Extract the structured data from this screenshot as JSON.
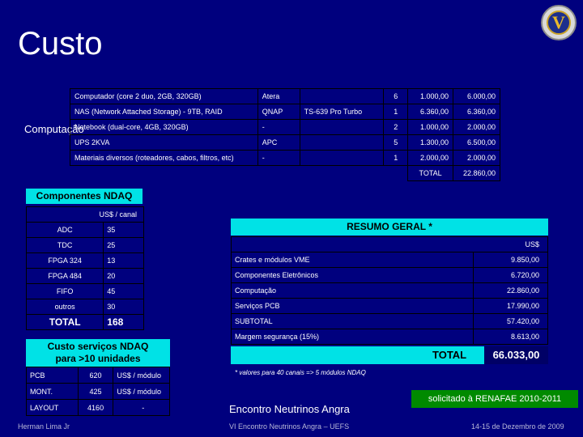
{
  "title": "Custo",
  "logo": {
    "letter": "V"
  },
  "computacao": {
    "label": "Computação",
    "rows": [
      {
        "item": "Computador (core 2 duo, 2GB, 320GB)",
        "brand": "Atera",
        "model": "",
        "qty": "6",
        "unit": "1.000,00",
        "total": "6.000,00"
      },
      {
        "item": "NAS (Network Attached Storage) - 9TB, RAID",
        "brand": "QNAP",
        "model": "TS-639 Pro Turbo",
        "qty": "1",
        "unit": "6.360,00",
        "total": "6.360,00"
      },
      {
        "item": "Notebook (dual-core, 4GB, 320GB)",
        "brand": "-",
        "model": "",
        "qty": "2",
        "unit": "1.000,00",
        "total": "2.000,00"
      },
      {
        "item": "UPS 2KVA",
        "brand": "APC",
        "model": "",
        "qty": "5",
        "unit": "1.300,00",
        "total": "6.500,00"
      },
      {
        "item": "Materiais diversos (roteadores, cabos, filtros, etc)",
        "brand": "-",
        "model": "",
        "qty": "1",
        "unit": "2.000,00",
        "total": "2.000,00"
      }
    ],
    "total_label": "TOTAL",
    "total_value": "22.860,00"
  },
  "componentes": {
    "title": "Componentes NDAQ",
    "header": "US$ / canal",
    "rows": [
      {
        "name": "ADC",
        "value": "35"
      },
      {
        "name": "TDC",
        "value": "25"
      },
      {
        "name": "FPGA 324",
        "value": "13"
      },
      {
        "name": "FPGA 484",
        "value": "20"
      },
      {
        "name": "FIFO",
        "value": "45"
      },
      {
        "name": "outros",
        "value": "30"
      }
    ],
    "total_label": "TOTAL",
    "total_value": "168"
  },
  "servicos": {
    "title_line1": "Custo serviços NDAQ",
    "title_line2": "para >10 unidades",
    "rows": [
      {
        "name": "PCB",
        "value": "620",
        "unit": "US$ / módulo"
      },
      {
        "name": "MONT.",
        "value": "425",
        "unit": "US$ / módulo"
      },
      {
        "name": "LAYOUT",
        "value": "4160",
        "unit": "-"
      }
    ]
  },
  "resumo": {
    "title": "RESUMO GERAL *",
    "currency": "US$",
    "rows": [
      {
        "name": "Crates e módulos VME",
        "value": "9.850,00"
      },
      {
        "name": "Componentes Eletrônicos",
        "value": "6.720,00"
      },
      {
        "name": "Computação",
        "value": "22.860,00"
      },
      {
        "name": "Serviços PCB",
        "value": "17.990,00"
      },
      {
        "name": "SUBTOTAL",
        "value": "57.420,00"
      },
      {
        "name": "Margem segurança (15%)",
        "value": "8.613,00"
      }
    ],
    "total_label": "TOTAL",
    "total_value": "66.033,00",
    "footnote": "* valores para 40 canais => 5 módulos NDAQ"
  },
  "solicitado": "solicitado à RENAFAE 2010-2011",
  "footer": {
    "event": "Encontro Neutrinos Angra",
    "author": "Herman Lima Jr",
    "event_sub": "VI Encontro Neutrinos Angra – UEFS",
    "date": "14-15 de Dezembro de 2009"
  }
}
